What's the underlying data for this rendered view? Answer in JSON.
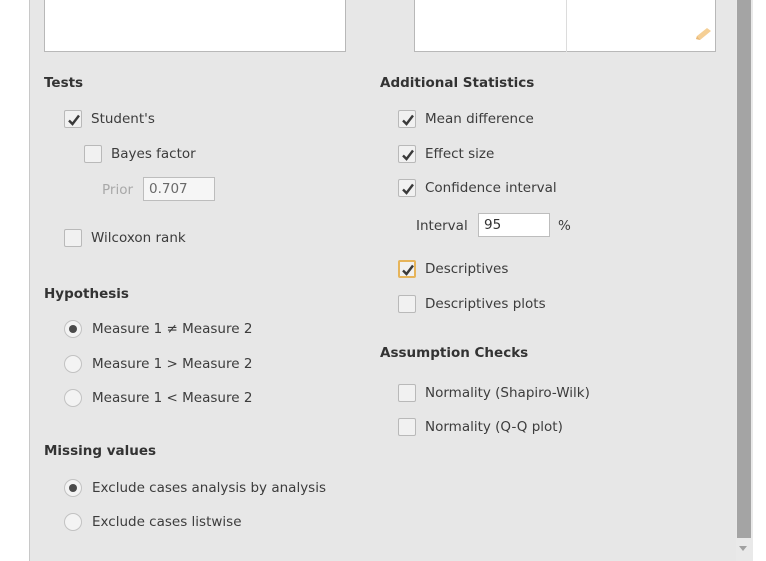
{
  "tests": {
    "heading": "Tests",
    "students": {
      "label": "Student's",
      "checked": true
    },
    "bayes": {
      "label": "Bayes factor",
      "checked": false
    },
    "prior": {
      "label": "Prior",
      "value": "0.707"
    },
    "wilcoxon": {
      "label": "Wilcoxon rank",
      "checked": false
    }
  },
  "hypothesis": {
    "heading": "Hypothesis",
    "options": [
      {
        "label": "Measure 1 ≠ Measure 2",
        "selected": true
      },
      {
        "label": "Measure 1 > Measure 2",
        "selected": false
      },
      {
        "label": "Measure 1 < Measure 2",
        "selected": false
      }
    ]
  },
  "missing": {
    "heading": "Missing values",
    "options": [
      {
        "label": "Exclude cases analysis by analysis",
        "selected": true
      },
      {
        "label": "Exclude cases listwise",
        "selected": false
      }
    ]
  },
  "additional": {
    "heading": "Additional Statistics",
    "mean_difference": {
      "label": "Mean difference",
      "checked": true
    },
    "effect_size": {
      "label": "Effect size",
      "checked": true
    },
    "confidence_interval": {
      "label": "Confidence interval",
      "checked": true
    },
    "interval": {
      "label": "Interval",
      "value": "95",
      "unit": "%"
    },
    "descriptives": {
      "label": "Descriptives",
      "checked": true
    },
    "descriptives_plots": {
      "label": "Descriptives plots",
      "checked": false
    }
  },
  "assumptions": {
    "heading": "Assumption Checks",
    "shapiro": {
      "label": "Normality (Shapiro-Wilk)",
      "checked": false
    },
    "qq": {
      "label": "Normality (Q-Q plot)",
      "checked": false
    }
  },
  "icons": {
    "pencil": "pencil-icon",
    "check": "checkmark-icon"
  },
  "colors": {
    "panel_bg": "#e7e7e7",
    "focus_border": "#e6b45a",
    "pencil": "#f2c98a"
  }
}
